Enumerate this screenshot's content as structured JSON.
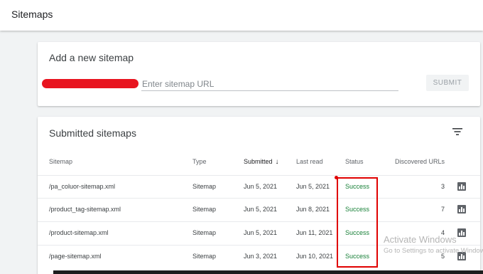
{
  "header": {
    "title": "Sitemaps"
  },
  "add_sitemap": {
    "heading": "Add a new sitemap",
    "url_placeholder": "Enter sitemap URL",
    "submit_label": "SUBMIT"
  },
  "submitted": {
    "heading": "Submitted sitemaps",
    "columns": {
      "sitemap": "Sitemap",
      "type": "Type",
      "submitted": "Submitted",
      "last_read": "Last read",
      "status": "Status",
      "discovered": "Discovered URLs"
    },
    "sort_indicator": "↓",
    "rows": [
      {
        "sitemap": "/pa_coluor-sitemap.xml",
        "type": "Sitemap",
        "submitted": "Jun 5, 2021",
        "last_read": "Jun 5, 2021",
        "status": "Success",
        "urls": "3"
      },
      {
        "sitemap": "/product_tag-sitemap.xml",
        "type": "Sitemap",
        "submitted": "Jun 5, 2021",
        "last_read": "Jun 8, 2021",
        "status": "Success",
        "urls": "7"
      },
      {
        "sitemap": "/product-sitemap.xml",
        "type": "Sitemap",
        "submitted": "Jun 5, 2021",
        "last_read": "Jun 11, 2021",
        "status": "Success",
        "urls": "4"
      },
      {
        "sitemap": "/page-sitemap.xml",
        "type": "Sitemap",
        "submitted": "Jun 3, 2021",
        "last_read": "Jun 10, 2021",
        "status": "Success",
        "urls": "5"
      }
    ]
  },
  "watermark": {
    "title": "Activate Windows",
    "subtitle": "Go to Settings to activate Windows."
  },
  "colors": {
    "success": "#188038",
    "highlight": "#e00000",
    "redaction": "#e8141f"
  },
  "icons": {
    "filter": "filter-icon",
    "sort": "arrow-down-icon",
    "report": "bar-chart-icon"
  }
}
